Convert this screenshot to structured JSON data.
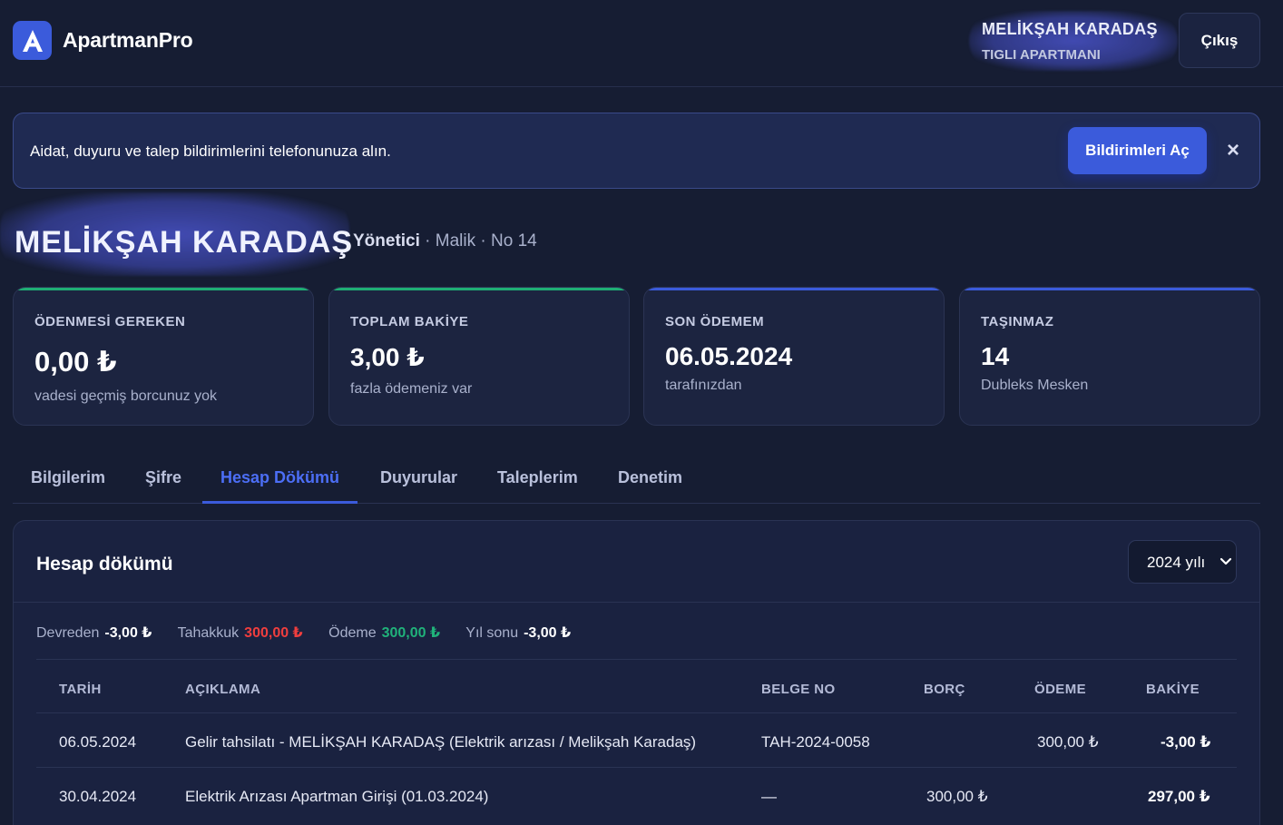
{
  "header": {
    "brand": "ApartmanPro",
    "logo_letter": "A",
    "user_name": "MELİKŞAH KARADAŞ",
    "user_apartment": "TIGLI APARTMANI",
    "logout_label": "Çıkış"
  },
  "banner": {
    "text": "Aidat, duyuru ve talep bildirimlerini telefonunuza alın.",
    "button_label": "Bildirimleri Aç",
    "close_label": "×"
  },
  "profile": {
    "name": "MELİKŞAH KARADAŞ",
    "role": "Yönetici",
    "meta": " · Malik · No 14"
  },
  "cards": [
    {
      "label": "ÖDENMESİ GEREKEN",
      "value": "0,00 ₺",
      "sub": "vadesi geçmiş borcunuz yok"
    },
    {
      "label": "TOPLAM BAKİYE",
      "value": "3,00 ₺",
      "sub": "fazla ödemeniz var"
    },
    {
      "label": "SON ÖDEMEM",
      "value": "06.05.2024",
      "sub": "tarafınızdan"
    },
    {
      "label": "TAŞINMAZ",
      "value": "14",
      "sub": "Dubleks Mesken"
    }
  ],
  "tabs": [
    {
      "label": "Bilgilerim"
    },
    {
      "label": "Şifre"
    },
    {
      "label": "Hesap Dökümü"
    },
    {
      "label": "Duyurular"
    },
    {
      "label": "Taleplerim"
    },
    {
      "label": "Denetim"
    }
  ],
  "statement": {
    "title": "Hesap dökümü",
    "year_selected": "2024 yılı",
    "summary": {
      "carry_label": "Devreden",
      "carry_value": "-3,00 ₺",
      "accrual_label": "Tahakkuk",
      "accrual_value": "300,00 ₺",
      "payment_label": "Ödeme",
      "payment_value": "300,00 ₺",
      "yearend_label": "Yıl sonu",
      "yearend_value": "-3,00 ₺"
    },
    "columns": [
      "TARİH",
      "AÇIKLAMA",
      "BELGE NO",
      "BORÇ",
      "ÖDEME",
      "BAKİYE"
    ],
    "rows": [
      {
        "date": "06.05.2024",
        "desc": "Gelir tahsilatı - MELİKŞAH KARADAŞ (Elektrik arızası / Melikşah Karadaş)",
        "doc": "TAH-2024-0058",
        "debt": "",
        "payment": "300,00 ₺",
        "balance": "-3,00 ₺"
      },
      {
        "date": "30.04.2024",
        "desc": "Elektrik Arızası Apartman Girişi (01.03.2024)",
        "doc": "—",
        "debt": "300,00 ₺",
        "payment": "",
        "balance": "297,00 ₺"
      }
    ]
  },
  "colors": {
    "accent": "#3b5bdb",
    "positive": "#20b27a",
    "negative": "#f03e3e",
    "background": "#161d33"
  }
}
